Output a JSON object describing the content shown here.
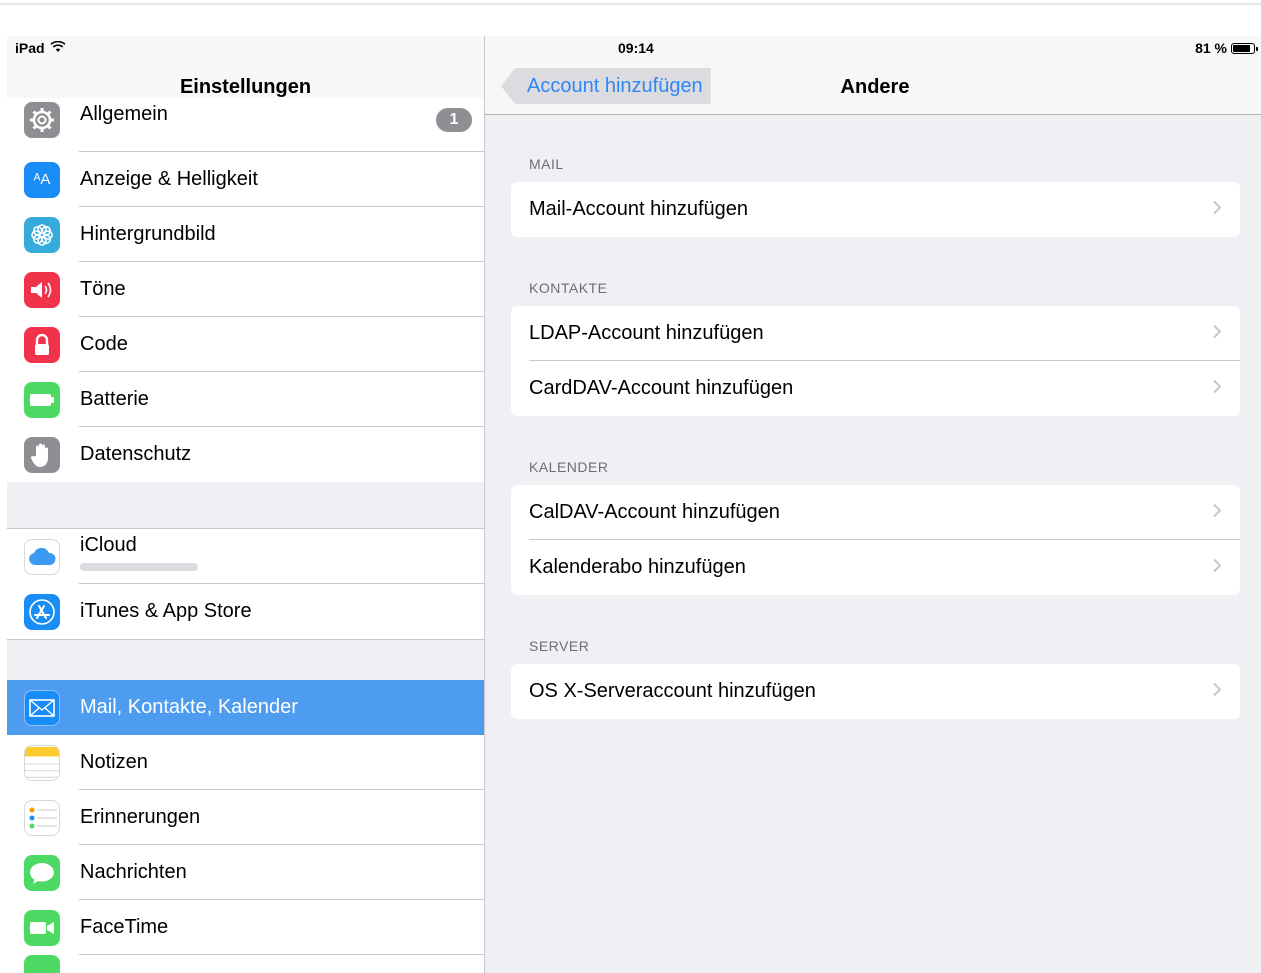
{
  "status_bar": {
    "carrier": "iPad",
    "time": "09:14",
    "battery_percent": "81 %"
  },
  "master": {
    "title": "Einstellungen",
    "groups": [
      {
        "items": [
          {
            "label": "Allgemein",
            "icon": "gear-icon",
            "color": "#8e8e93",
            "badge": "1"
          },
          {
            "label": "Anzeige & Helligkeit",
            "icon": "display-brightness-icon",
            "color": "#1a8cf6"
          },
          {
            "label": "Hintergrundbild",
            "icon": "wallpaper-flower-icon",
            "color": "#37aadc"
          },
          {
            "label": "Töne",
            "icon": "speaker-icon",
            "color": "#f0334b"
          },
          {
            "label": "Code",
            "icon": "lock-icon",
            "color": "#f0334b"
          },
          {
            "label": "Batterie",
            "icon": "battery-icon",
            "color": "#4cd964"
          },
          {
            "label": "Datenschutz",
            "icon": "hand-icon",
            "color": "#8e8e93"
          }
        ]
      },
      {
        "items": [
          {
            "label": "iCloud",
            "icon": "cloud-icon",
            "color": "#ffffff"
          },
          {
            "label": "iTunes & App Store",
            "icon": "app-store-icon",
            "color": "#1a8cf6"
          }
        ]
      },
      {
        "items": [
          {
            "label": "Mail, Kontakte, Kalender",
            "icon": "mail-icon",
            "color": "#1a8cf6",
            "selected": true
          },
          {
            "label": "Notizen",
            "icon": "notes-icon",
            "color": "#ffffff"
          },
          {
            "label": "Erinnerungen",
            "icon": "reminders-icon",
            "color": "#ffffff"
          },
          {
            "label": "Nachrichten",
            "icon": "messages-icon",
            "color": "#4cd964"
          },
          {
            "label": "FaceTime",
            "icon": "facetime-icon",
            "color": "#4cd964"
          }
        ]
      }
    ]
  },
  "detail": {
    "back_label": "Account hinzufügen",
    "title": "Andere",
    "sections": [
      {
        "header": "MAIL",
        "items": [
          "Mail-Account hinzufügen"
        ]
      },
      {
        "header": "KONTAKTE",
        "items": [
          "LDAP-Account hinzufügen",
          "CardDAV-Account hinzufügen"
        ]
      },
      {
        "header": "KALENDER",
        "items": [
          "CalDAV-Account hinzufügen",
          "Kalenderabo hinzufügen"
        ]
      },
      {
        "header": "SERVER",
        "items": [
          "OS X-Serveraccount hinzufügen"
        ]
      }
    ]
  }
}
